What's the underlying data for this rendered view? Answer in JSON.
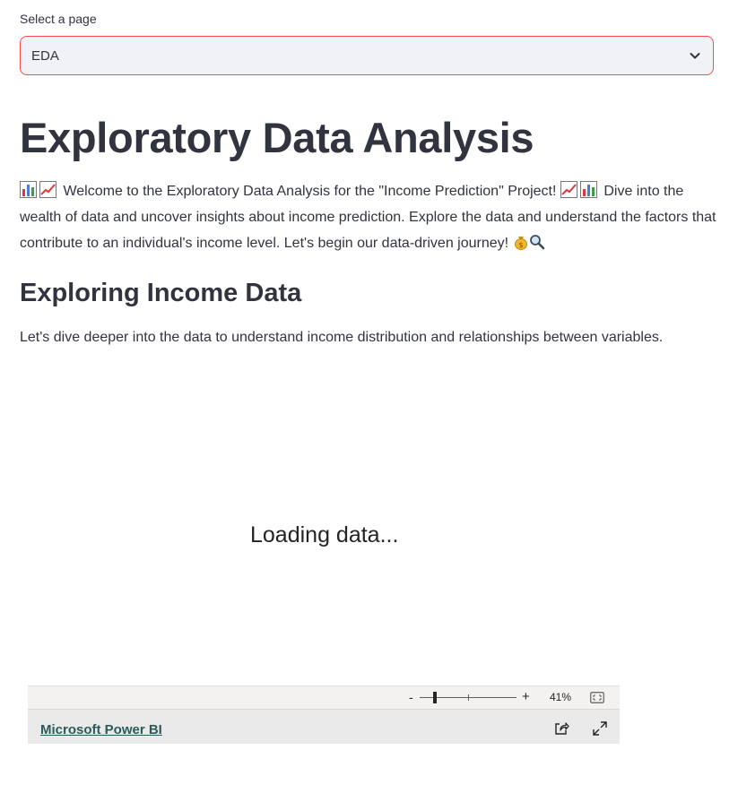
{
  "page_select": {
    "label": "Select a page",
    "selected": "EDA"
  },
  "header": {
    "title": "Exploratory Data Analysis"
  },
  "intro": {
    "text": "Welcome to the Exploratory Data Analysis for the \"Income Prediction\" Project!",
    "text2": "Dive into the wealth of data and uncover insights about income prediction. Explore the data and understand the factors that contribute to an individual's income level. Let's begin our data-driven journey!",
    "icons": [
      "bar-chart-emoji-icon",
      "chart-increasing-emoji-icon",
      "money-bag-emoji-icon",
      "magnifying-glass-emoji-icon"
    ]
  },
  "section": {
    "title": "Exploring Income Data",
    "description": "Let's dive deeper into the data to understand income distribution and relationships between variables."
  },
  "powerbi": {
    "loading_text": "Loading data...",
    "zoom_minus": "-",
    "zoom_plus": "+",
    "zoom_level": "41%",
    "link_text": "Microsoft Power BI"
  },
  "colors": {
    "accent": "#ff4b4b",
    "text": "#31333f",
    "select_bg": "#f0f2f6",
    "link": "#2a5b5a"
  }
}
